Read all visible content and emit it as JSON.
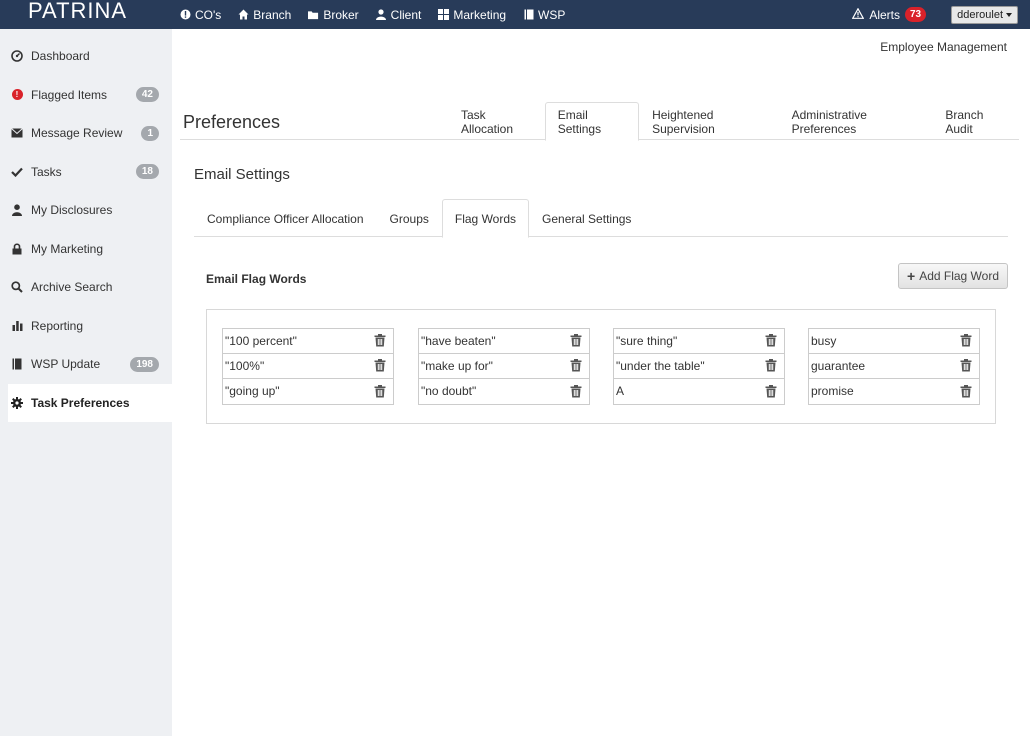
{
  "brand": "PATRINA",
  "topnav": [
    {
      "label": "CO's",
      "icon": "info-circle-icon"
    },
    {
      "label": "Branch",
      "icon": "home-icon"
    },
    {
      "label": "Broker",
      "icon": "folder-icon"
    },
    {
      "label": "Client",
      "icon": "user-icon"
    },
    {
      "label": "Marketing",
      "icon": "grid-icon"
    },
    {
      "label": "WSP",
      "icon": "book-icon"
    }
  ],
  "alerts": {
    "label": "Alerts",
    "count": "73",
    "icon": "warning-icon"
  },
  "user": {
    "name": "dderoulet"
  },
  "sidebar": {
    "items": [
      {
        "label": "Dashboard",
        "icon": "dashboard-icon",
        "count": ""
      },
      {
        "label": "Flagged Items",
        "icon": "exclamation-icon",
        "count": "42"
      },
      {
        "label": "Message Review",
        "icon": "envelope-icon",
        "count": "1"
      },
      {
        "label": "Tasks",
        "icon": "checkmark-icon",
        "count": "18"
      },
      {
        "label": "My Disclosures",
        "icon": "user-icon",
        "count": ""
      },
      {
        "label": "My Marketing",
        "icon": "lock-icon",
        "count": ""
      },
      {
        "label": "Archive Search",
        "icon": "search-icon",
        "count": ""
      },
      {
        "label": "Reporting",
        "icon": "bar-chart-icon",
        "count": ""
      },
      {
        "label": "WSP Update",
        "icon": "book-icon",
        "count": "198"
      },
      {
        "label": "Task Preferences",
        "icon": "gear-icon",
        "count": ""
      }
    ]
  },
  "main": {
    "employee_management": "Employee Management",
    "preferences_title": "Preferences",
    "tabs": [
      "Task Allocation",
      "Email Settings",
      "Heightened Supervision",
      "Administrative Preferences",
      "Branch Audit"
    ],
    "active_tab": "Email Settings",
    "email_settings_title": "Email Settings",
    "subtabs": [
      "Compliance Officer Allocation",
      "Groups",
      "Flag Words",
      "General Settings"
    ],
    "active_subtab": "Flag Words",
    "section_title": "Email Flag Words",
    "add_button": "Add Flag Word",
    "flag_words": [
      [
        "\"100 percent\"",
        "\"100%\"",
        "\"going up\""
      ],
      [
        "\"have beaten\"",
        "\"make up for\"",
        "\"no doubt\""
      ],
      [
        "\"sure thing\"",
        "\"under the table\"",
        "A"
      ],
      [
        "busy",
        "guarantee",
        "promise"
      ]
    ]
  },
  "colors": {
    "topbar": "#283b59",
    "sidebar": "#eef0f3",
    "alert_badge": "#d9222a",
    "count_badge": "#a4a8ad"
  }
}
